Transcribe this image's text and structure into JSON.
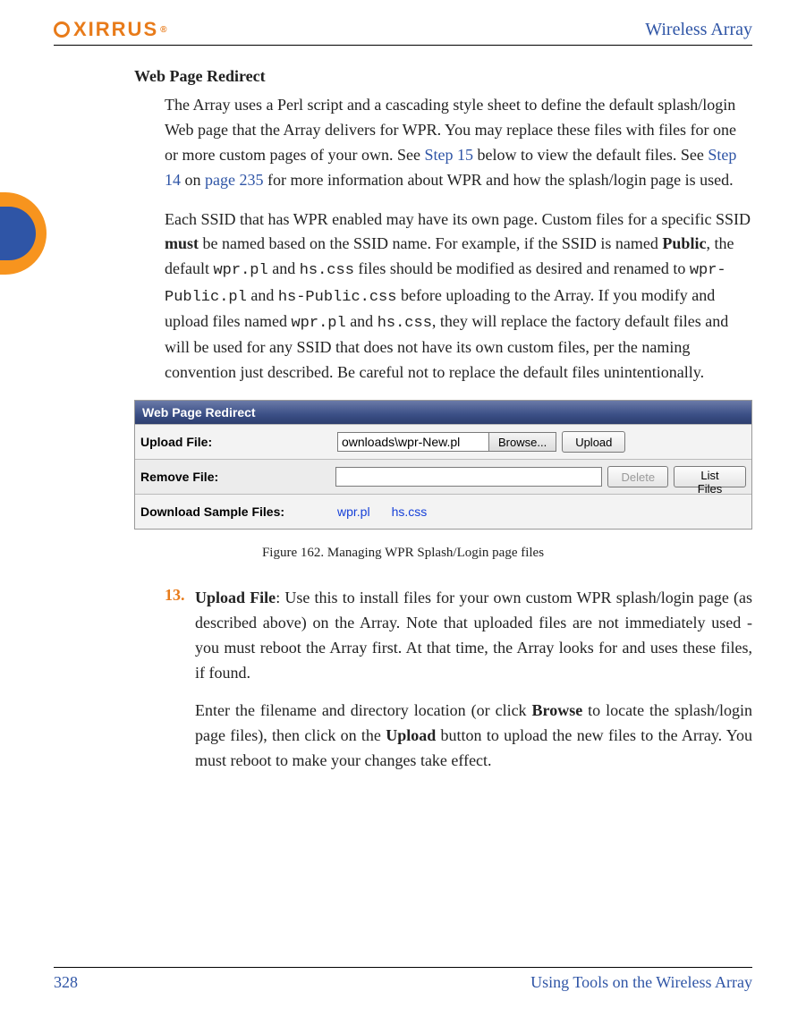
{
  "header": {
    "logo_text": "XIRRUS",
    "product": "Wireless Array"
  },
  "section_title": "Web Page Redirect",
  "para1": {
    "t1": "The Array uses a Perl script and a cascading style sheet to define the default splash/login Web page that the Array delivers for WPR. You may replace these files with files for one or more custom pages of your own. See ",
    "link1": "Step 15",
    "t2": " below to view the default files. See ",
    "link2": "Step 14",
    "t3": " on ",
    "link3": "page 235",
    "t4": " for more information about WPR and how the splash/login page is used."
  },
  "para2": {
    "t1": "Each SSID that has WPR enabled may have its own page. Custom files for a specific SSID ",
    "b1": "must",
    "t2": " be named based on the SSID name. For example, if the SSID is named ",
    "b2": "Public",
    "t3": ", the default ",
    "m1": "wpr.pl",
    "t4": " and ",
    "m2": "hs.css",
    "t5": " files should be modified as desired and renamed to ",
    "m3": "wpr-Public.pl",
    "t6": " and ",
    "m4": "hs-Public.css",
    "t7": " before uploading to the Array. If you modify and upload files named ",
    "m5": "wpr.pl",
    "t8": " and ",
    "m6": "hs.css",
    "t9": ", they will replace the factory default files and will be used for any SSID that does not have its own custom files, per the naming convention just described. Be careful not to replace the default files unintentionally."
  },
  "ui": {
    "title": "Web Page Redirect",
    "upload_label": "Upload File:",
    "upload_value": "ownloads\\wpr-New.pl",
    "browse": "Browse...",
    "upload_btn": "Upload",
    "remove_label": "Remove File:",
    "delete_btn": "Delete",
    "listfiles_btn": "List Files",
    "download_label": "Download Sample Files:",
    "file1": "wpr.pl",
    "file2": "hs.css"
  },
  "figure_caption": "Figure 162. Managing WPR Splash/Login page files",
  "step13": {
    "num": "13.",
    "p1a": "Upload File",
    "p1b": ": Use this to install files for your own custom WPR splash/login page (as described above) on the Array. Note that uploaded files are not immediately used - you must reboot the Array first. At that time, the Array looks for and uses these files, if found.",
    "p2a": "Enter the filename and directory location (or click ",
    "p2b": "Browse",
    "p2c": " to locate the splash/login page files), then click on the ",
    "p2d": "Upload",
    "p2e": " button to upload the new files to the Array. You must reboot to make your changes take effect."
  },
  "footer": {
    "page": "328",
    "title": "Using Tools on the Wireless Array"
  }
}
